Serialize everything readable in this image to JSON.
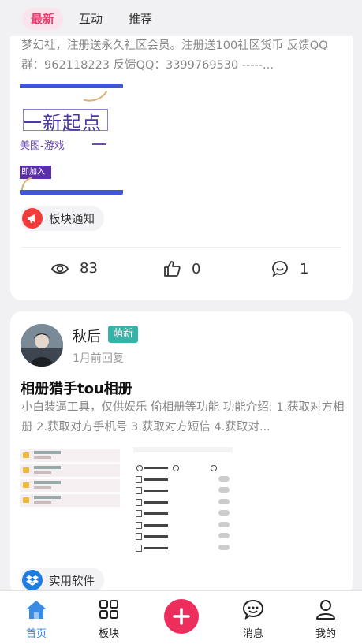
{
  "tabs": [
    {
      "label": "最新",
      "active": true
    },
    {
      "label": "互动",
      "active": false
    },
    {
      "label": "推荐",
      "active": false
    }
  ],
  "post1": {
    "snippet": "梦幻社，注册送永久社区会员。注册送100社区货币 反馈QQ群：962118223 反馈QQ：3399769530 -----...",
    "thumbnail": {
      "headline": "一新起点",
      "subtitle": "美图-游戏",
      "dash": "—",
      "join_label": "即加入"
    },
    "category_tag": {
      "label": "板块通知",
      "icon": "megaphone-icon",
      "color": "#f23b3b"
    },
    "stats": {
      "views": "83",
      "likes": "0",
      "comments": "1"
    }
  },
  "post2": {
    "username": "秋后",
    "badge": "萌新",
    "time": "1月前回复",
    "title": "相册猎手tou相册",
    "snippet": "小白装逼工具，仅供娱乐 偷相册等功能 功能介绍: 1.获取对方相册 2.获取对方手机号 3.获取对方短信 4.获取对...",
    "category_tag": {
      "label": "实用软件",
      "icon": "dropbox-icon",
      "color": "#1f7de0"
    }
  },
  "bottom_nav": [
    {
      "label": "首页",
      "icon": "home-icon",
      "active": true
    },
    {
      "label": "板块",
      "icon": "grid-icon",
      "active": false
    },
    {
      "label": "",
      "icon": "plus-icon",
      "active": false
    },
    {
      "label": "消息",
      "icon": "chat-icon",
      "active": false
    },
    {
      "label": "我的",
      "icon": "user-icon",
      "active": false
    }
  ],
  "colors": {
    "accent": "#ed2d5b",
    "active_nav": "#2f82e0",
    "badge": "#36b3a8"
  }
}
